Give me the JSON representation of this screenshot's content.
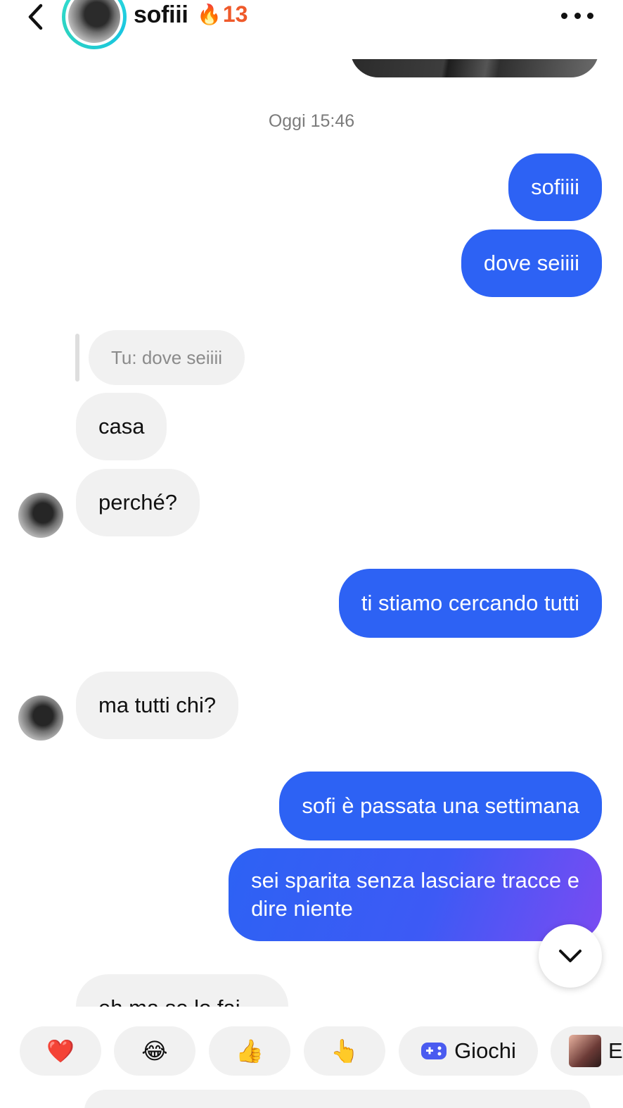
{
  "header": {
    "contact_name": "sofiii",
    "streak_emoji": "🔥",
    "streak_count": "13"
  },
  "timestamp": "Oggi 15:46",
  "messages": {
    "m1": "sofiiii",
    "m2": "dove seiiii",
    "reply_quote": "Tu: dove seiiii",
    "m3": "casa",
    "m4": "perché?",
    "m5": "ti stiamo cercando tutti",
    "m6": "ma tutti chi?",
    "m7": "sofi è passata una settimana",
    "m8_line1": "sei sparita senza lasciare tracce e",
    "m8_line2": "dire niente",
    "m9_partial": "eh ma se lo fai"
  },
  "reactions": {
    "heart": "❤️",
    "laugh": "😂",
    "thumbs": "👍",
    "point": "👆",
    "games_label": "Giochi",
    "effects_label": "E"
  },
  "colors": {
    "outgoing": "#2d62f4",
    "incoming": "#f1f1f1",
    "streak": "#ef5a2b",
    "ring": "#34e0d8"
  }
}
